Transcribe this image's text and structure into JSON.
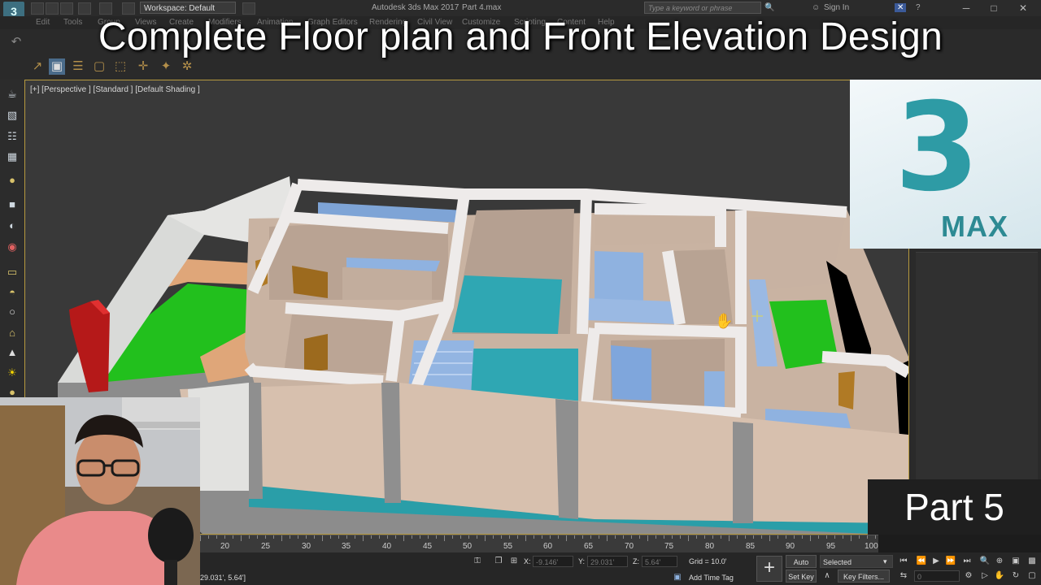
{
  "app": {
    "window_title": "Autodesk 3ds Max 2017",
    "file_name": "Part 4.max",
    "app_icon": "3",
    "workspace": "Workspace: Default",
    "search_placeholder": "Type a keyword or phrase",
    "sign_in": "Sign In",
    "help_icon": "?"
  },
  "menus": [
    "Edit",
    "Tools",
    "Group",
    "Views",
    "Create",
    "Modifiers",
    "Animation",
    "Graph Editors",
    "Rendering",
    "Civil View",
    "Customize",
    "Scripting",
    "Content",
    "Help"
  ],
  "viewport": {
    "label": "[+] [Perspective ] [Standard ] [Default Shading ]"
  },
  "overlay": {
    "title": "Complete Floor plan and Front Elevation Design",
    "part": "Part 5"
  },
  "logo": {
    "number": "3",
    "text": "MAX"
  },
  "timeline": {
    "ticks": [
      "20",
      "25",
      "30",
      "35",
      "40",
      "45",
      "50",
      "55",
      "60",
      "65",
      "70",
      "75",
      "80",
      "85",
      "90",
      "95",
      "100"
    ]
  },
  "status": {
    "coord_readout": "29.031', 5.64']",
    "x_label": "X:",
    "x_value": "-9.146'",
    "y_label": "Y:",
    "y_value": "29.031'",
    "z_label": "Z:",
    "z_value": "5.64'",
    "grid": "Grid = 10.0'",
    "add_time_tag": "Add Time Tag",
    "auto_key": "Auto Key",
    "set_key": "Set Key",
    "selected": "Selected",
    "key_filters": "Key Filters...",
    "frame": "0"
  },
  "colors": {
    "accent_border": "#b79a3f",
    "room_floor": "#c9b3a2",
    "wall": "#eae7e6",
    "lawn": "#22c01d",
    "pool": "#2fa7b3",
    "glass": "#8fb2e0",
    "door": "#9c6a1e",
    "column": "#c11b1b"
  }
}
